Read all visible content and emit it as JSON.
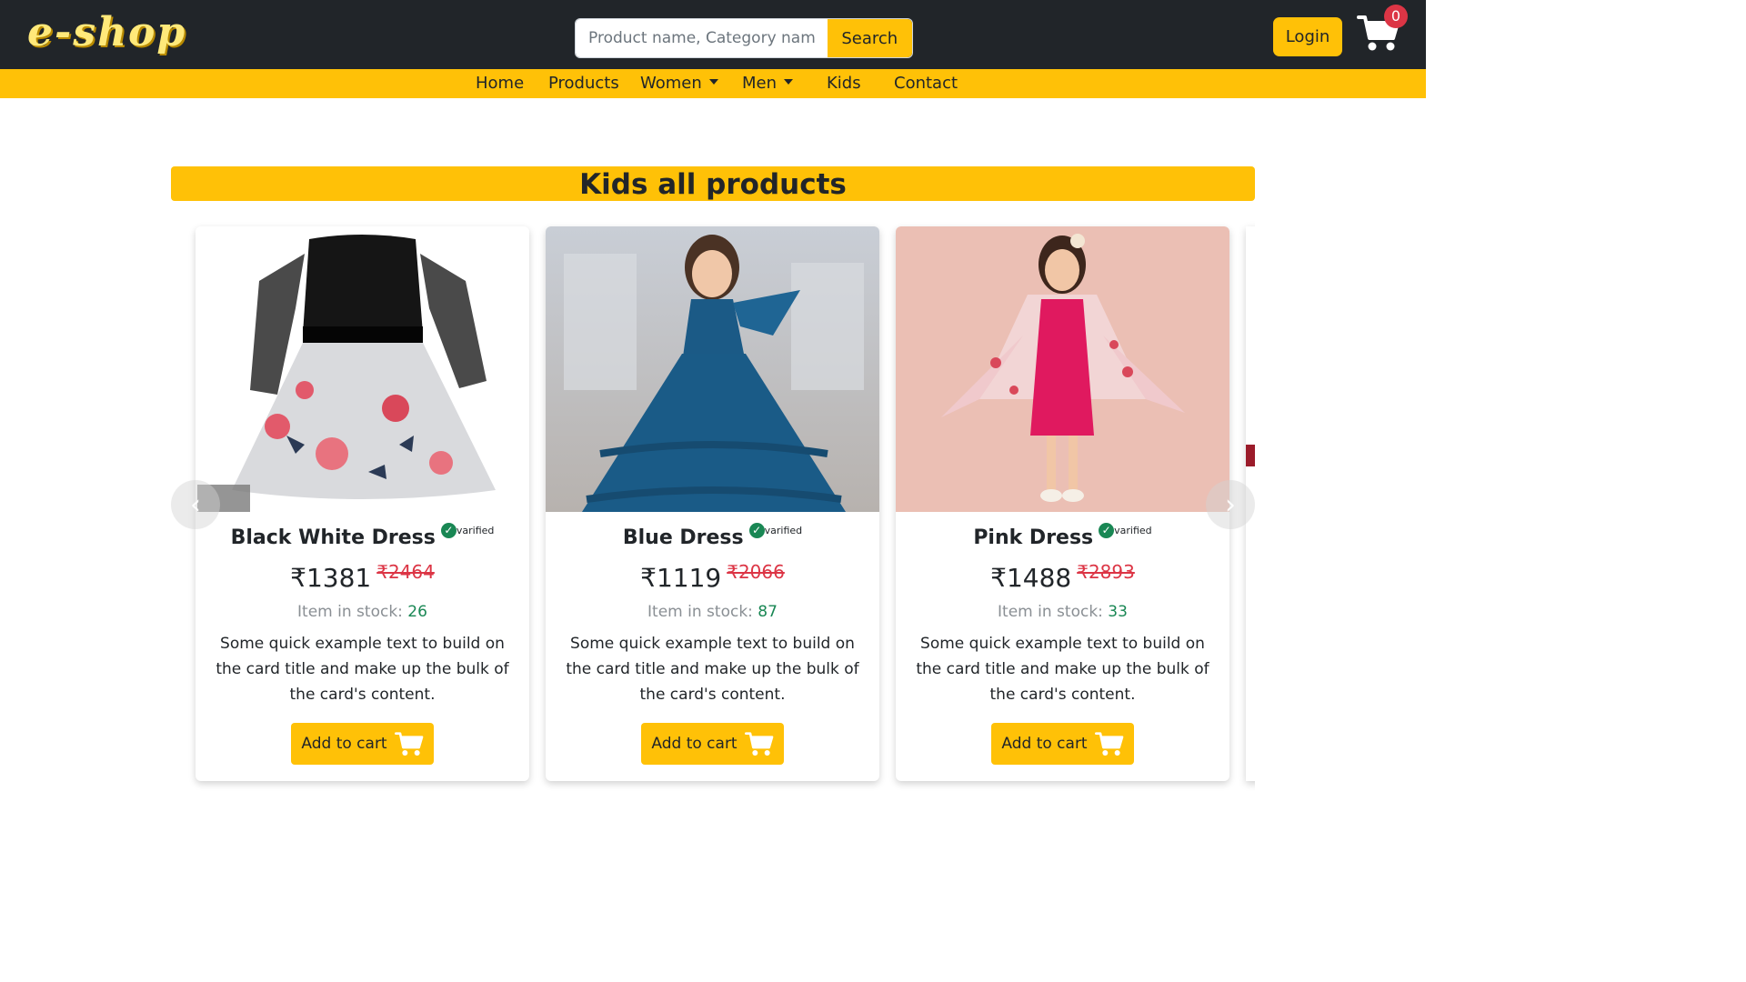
{
  "header": {
    "logo": "e-shop",
    "search": {
      "placeholder": "Product name, Category name",
      "value": "",
      "button_label": "Search"
    },
    "login_label": "Login",
    "cart_count": "0"
  },
  "nav": {
    "items": [
      {
        "label": "Home"
      },
      {
        "label": "Products"
      },
      {
        "label": "Women",
        "dropdown": true
      },
      {
        "label": "Men",
        "dropdown": true
      },
      {
        "label": "Kids"
      },
      {
        "label": "Contact"
      }
    ]
  },
  "main": {
    "heading": "Kids all products",
    "products": [
      {
        "title": "Black White Dress",
        "verified_label": "varified",
        "price": "₹1381",
        "old_price": "₹2464",
        "stock_label": "Item in stock: ",
        "stock": "26",
        "description": "Some quick example text to build on the card title and make up the bulk of the card's content.",
        "button_label": "Add to cart"
      },
      {
        "title": "Blue Dress",
        "verified_label": "varified",
        "price": "₹1119",
        "old_price": "₹2066",
        "stock_label": "Item in stock: ",
        "stock": "87",
        "description": "Some quick example text to build on the card title and make up the bulk of the card's content.",
        "button_label": "Add to cart"
      },
      {
        "title": "Pink Dress",
        "verified_label": "varified",
        "price": "₹1488",
        "old_price": "₹2893",
        "stock_label": "Item in stock: ",
        "stock": "33",
        "description": "Some quick example text to build on the card title and make up the bulk of the card's content.",
        "button_label": "Add to cart"
      }
    ]
  },
  "colors": {
    "header_bg": "#212529",
    "accent": "#ffc107",
    "logo": "#ffe97a",
    "badge": "#dc3545",
    "old_price": "#dc3545",
    "stock": "#198754",
    "verified": "#198754"
  },
  "icons": {
    "cart": "shopping-cart-icon",
    "verified": "check-circle-icon",
    "prev": "chevron-left-icon",
    "next": "chevron-right-icon"
  }
}
